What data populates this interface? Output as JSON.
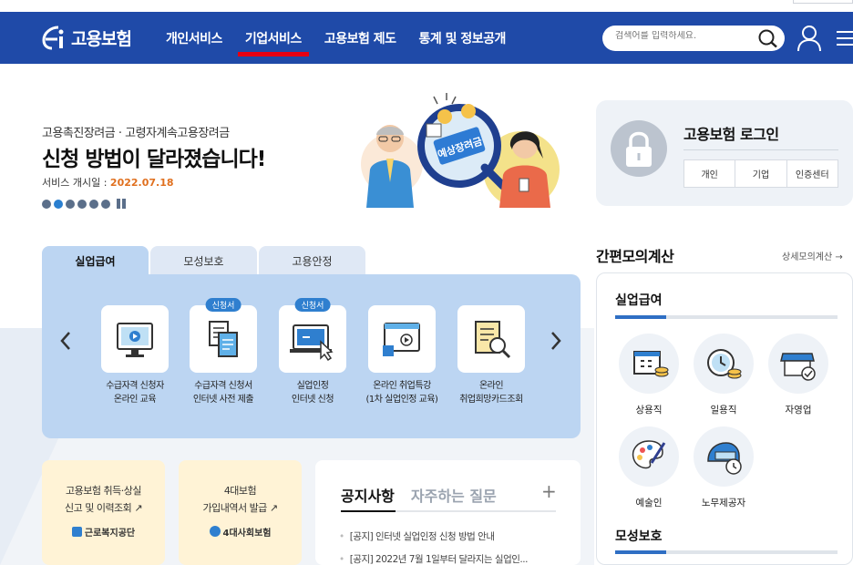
{
  "header": {
    "logo_text": "고용보험",
    "nav": [
      "개인서비스",
      "기업서비스",
      "고용보험 제도",
      "통계 및 정보공개"
    ],
    "active_nav": "기업서비스",
    "search_placeholder": "검색어를 입력하세요."
  },
  "banner": {
    "subtitle": "고용촉진장려금 · 고령자계속고용장려금",
    "title": "신청 방법이 달라졌습니다!",
    "date_label": "서비스 개시일 :",
    "date_value": "2022.07.18",
    "illust_sign": "예상장려금"
  },
  "login": {
    "title": "고용보험 로그인",
    "buttons": [
      "개인",
      "기업",
      "인증센터"
    ]
  },
  "tabs": [
    "실업급여",
    "모성보호",
    "고용안정"
  ],
  "services": [
    {
      "label1": "수급자격 신청자",
      "label2": "온라인 교육",
      "badge": ""
    },
    {
      "label1": "수급자격 신청서",
      "label2": "인터넷 사전 제출",
      "badge": "신청서"
    },
    {
      "label1": "실업인정",
      "label2": "인터넷 신청",
      "badge": "신청서"
    },
    {
      "label1": "온라인 취업특강",
      "label2": "(1차 실업인정 교육)",
      "badge": ""
    },
    {
      "label1": "온라인",
      "label2": "취업희망카드조회",
      "badge": ""
    }
  ],
  "cards": [
    {
      "line1": "고용보험 취득·상실",
      "line2": "신고 및 이력조회",
      "org": "근로복지공단"
    },
    {
      "line1": "4대보험",
      "line2": "가입내역서 발급",
      "org": "4대사회보험"
    }
  ],
  "notice": {
    "tabs": [
      "공지사항",
      "자주하는 질문"
    ],
    "plus": "+",
    "items": [
      "[공지] 인터넷 실업인정 신청 방법 안내",
      "[공지] 2022년 7월 1일부터 달라지는 실업인..."
    ]
  },
  "calc": {
    "title": "간편모의계산",
    "more": "상세모의계산 →",
    "section1": "실업급여",
    "jobs": [
      "상용직",
      "일용직",
      "자영업",
      "예술인",
      "노무제공자"
    ],
    "section2": "모성보호"
  }
}
